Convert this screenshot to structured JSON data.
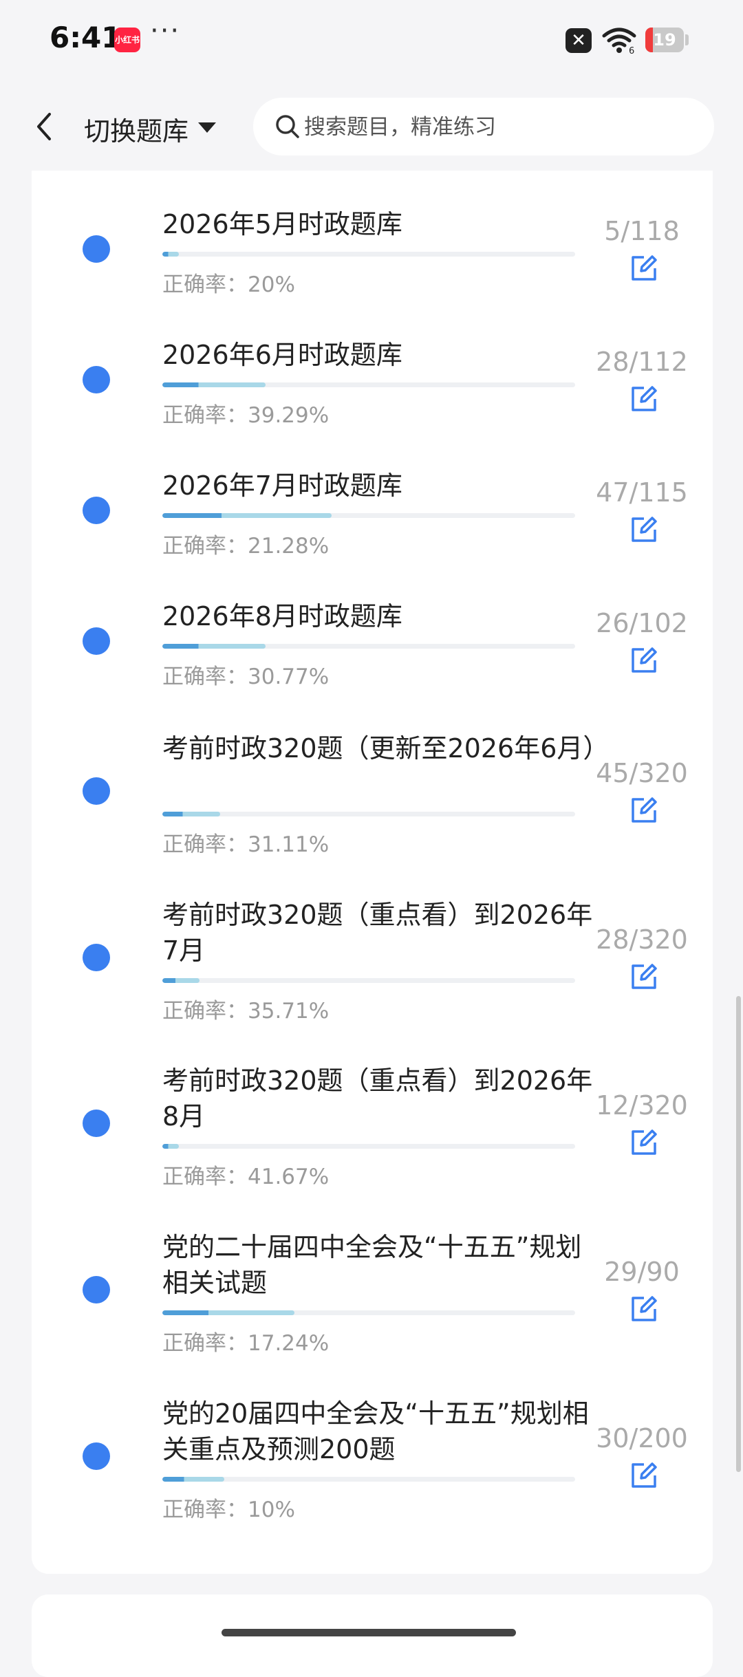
{
  "status_bar": {
    "time": "6:41",
    "app_badge": "小红书",
    "more": "···",
    "battery": "19",
    "battery_level": 0.19,
    "icons": [
      "close-notification-icon",
      "wifi-icon",
      "battery-icon"
    ],
    "battery_color": "#f03c3c"
  },
  "header": {
    "switch_label": "切换题库",
    "search_placeholder": "搜索题目，精准练习",
    "icons": [
      "back-arrow-icon",
      "caret-down-icon",
      "search-icon"
    ]
  },
  "colors": {
    "dot": "#3a7ff0",
    "progress_dark": "#4f9ed8",
    "progress_light": "#a9d8e8",
    "accent_icon": "#3a7ff0"
  },
  "accuracy_prefix": "正确率：",
  "items": [
    {
      "title": "2026年5月时政题库",
      "accuracy": "20%",
      "count": "5/118",
      "progress": 0.04
    },
    {
      "title": "2026年6月时政题库",
      "accuracy": "39.29%",
      "count": "28/112",
      "progress": 0.25
    },
    {
      "title": "2026年7月时政题库",
      "accuracy": "21.28%",
      "count": "47/115",
      "progress": 0.41
    },
    {
      "title": "2026年8月时政题库",
      "accuracy": "30.77%",
      "count": "26/102",
      "progress": 0.25
    },
    {
      "title": "考前时政320题（更新至2026年6月）",
      "accuracy": "31.11%",
      "count": "45/320",
      "progress": 0.14
    },
    {
      "title": "考前时政320题（重点看）到2026年7月",
      "accuracy": "35.71%",
      "count": "28/320",
      "progress": 0.09
    },
    {
      "title": "考前时政320题（重点看）到2026年8月",
      "accuracy": "41.67%",
      "count": "12/320",
      "progress": 0.04
    },
    {
      "title": "党的二十届四中全会及“十五五”规划相关试题",
      "accuracy": "17.24%",
      "count": "29/90",
      "progress": 0.32
    },
    {
      "title": "党的20届四中全会及“十五五”规划相关重点及预测200题",
      "accuracy": "10%",
      "count": "30/200",
      "progress": 0.15
    }
  ]
}
